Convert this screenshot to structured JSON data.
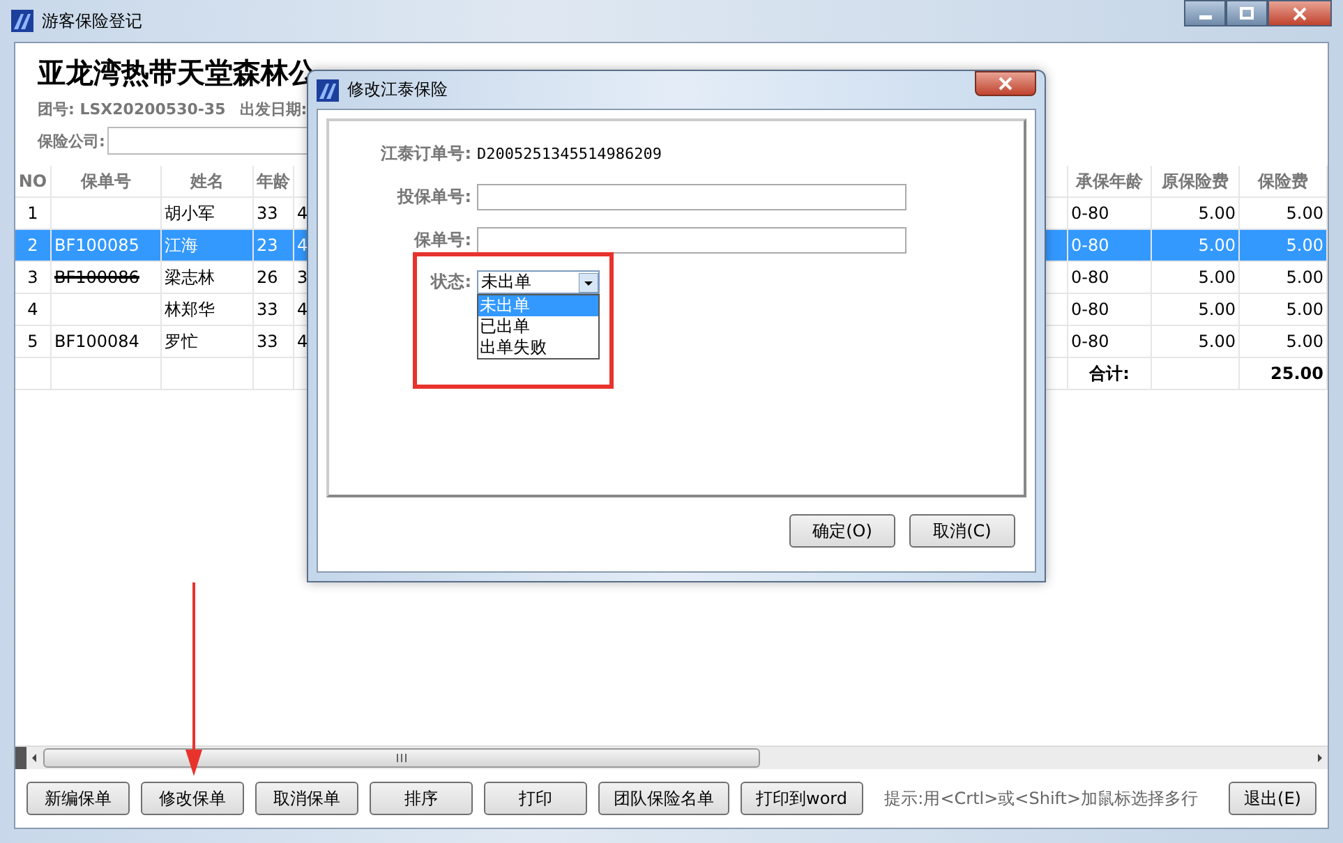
{
  "window": {
    "title": "游客保险登记"
  },
  "header": {
    "title": "亚龙湾热带天堂森林公",
    "group": "团号: LSX20200530-35",
    "departure_label": "出发日期:",
    "insurer_label": "保险公司:"
  },
  "table": {
    "columns": [
      "NO",
      "保单号",
      "姓名",
      "年龄",
      "承保年龄",
      "原保险费",
      "保险费"
    ],
    "rows": [
      {
        "no": "1",
        "name": "胡小军",
        "age": "33",
        "column_5": "4",
        "age_range": "0-80",
        "original_fee": "5.00",
        "fee": "5.00",
        "selected": false
      },
      {
        "no": "2",
        "policy": "BF100085",
        "name": "江海",
        "age": "23",
        "column_5": "4",
        "age_range": "0-80",
        "original_fee": "5.00",
        "fee": "5.00",
        "selected": true,
        "cancelled": false
      },
      {
        "no": "3",
        "policy": "BF100086",
        "name": "梁志林",
        "age": "26",
        "column_5": "3",
        "age_range": "0-80",
        "original_fee": "5.00",
        "fee": "5.00",
        "selected": false,
        "cancelled": true
      },
      {
        "no": "4",
        "name": "林郑华",
        "age": "33",
        "column_5": "4",
        "age_range": "0-80",
        "original_fee": "5.00",
        "fee": "5.00",
        "selected": false
      },
      {
        "no": "5",
        "policy": "BF100084",
        "name": "罗忙",
        "age": "33",
        "column_5": "4",
        "age_range": "0-80",
        "original_fee": "5.00",
        "fee": "5.00",
        "selected": false,
        "cancelled": false
      }
    ],
    "total": {
      "label": "合计:",
      "value": "25.00"
    }
  },
  "toolbar": {
    "buttons": [
      "新编保单",
      "修改保单",
      "取消保单",
      "排序",
      "打印",
      "团队保险名单",
      "打印到word"
    ],
    "hint": "提示:用<Crtl>或<Shift>加鼠标选择多行",
    "exit": "退出(E)"
  },
  "dialog": {
    "title": "修改江泰保险",
    "order_label": "江泰订单号:",
    "order_no": "D2005251345514986209",
    "application_label": "投保单号:",
    "policy_label": "保单号:",
    "status_label": "状态:",
    "status_value": "未出单",
    "status_options": [
      {
        "label": "未出单",
        "selected": true
      },
      {
        "label": "已出单",
        "selected": false
      },
      {
        "label": "出单失败",
        "selected": false
      }
    ],
    "buttons": [
      "确定(O)",
      "取消(C)"
    ]
  }
}
